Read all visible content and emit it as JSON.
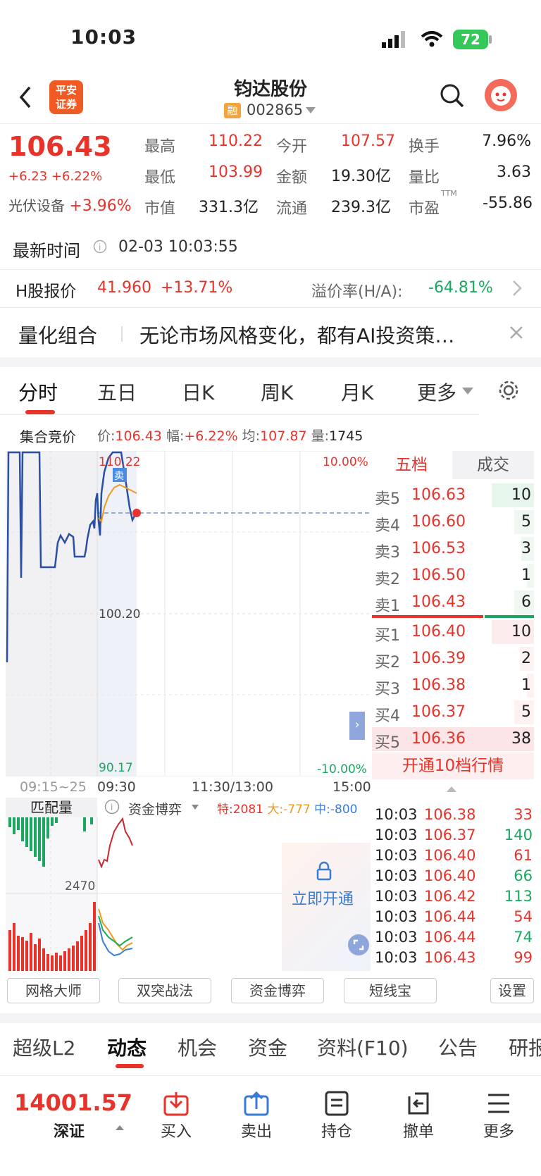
{
  "status": {
    "time": "10:03",
    "battery": "72"
  },
  "header": {
    "logo_line1": "平安",
    "logo_line2": "证券",
    "name": "钧达股份",
    "rong": "融",
    "code": "002865"
  },
  "quote": {
    "price": "106.43",
    "change": "+6.23",
    "change_pct": "+6.22%",
    "sector": "光伏设备",
    "sector_pct": "+3.96%",
    "high_label": "最高",
    "high": "110.22",
    "open_label": "今开",
    "open": "107.57",
    "turnover_label": "换手",
    "turnover": "7.96%",
    "low_label": "最低",
    "low": "103.99",
    "amount_label": "金额",
    "amount": "19.30亿",
    "vol_ratio_label": "量比",
    "vol_ratio": "3.63",
    "mcap_label": "市值",
    "mcap": "331.3亿",
    "float_label": "流通",
    "float": "239.3亿",
    "pe_label": "市盈",
    "pe_sup": "TTM",
    "pe": "-55.86"
  },
  "update": {
    "label": "最新时间",
    "value": "02-03 10:03:55"
  },
  "hshare": {
    "label": "H股报价",
    "price": "41.960",
    "pct": "+13.71%",
    "premium_label": "溢价率(H/A):",
    "premium": "-64.81%"
  },
  "promo": {
    "tag": "量化组合",
    "text": "无论市场风格变化，都有AI投资策…"
  },
  "tabs": [
    "分时",
    "五日",
    "日K",
    "周K",
    "月K",
    "更多"
  ],
  "auction": {
    "label": "集合竞价",
    "price_label": "价:",
    "price": "106.43",
    "pct_label": "幅:",
    "pct": "+6.22%",
    "avg_label": "均:",
    "avg": "107.87",
    "vol_label": "量:",
    "vol": "1745"
  },
  "chart": {
    "top_price": "110.22",
    "mid_price": "100.20",
    "low_price": "90.17",
    "top_pct": "10.00%",
    "low_pct": "-10.00%",
    "sell_mark": "卖",
    "times": [
      "09:15~25",
      "09:30",
      "11:30/13:00",
      "15:00"
    ]
  },
  "subchart": {
    "tab_label": "匹配量",
    "indicator": "资金博弈",
    "te_label": "特:",
    "te": "2081",
    "da_label": "大:",
    "da": "-777",
    "zhong_label": "中:",
    "zhong": "-800",
    "axis_value": "2470",
    "unlock": "立即开通"
  },
  "orderbook": {
    "tab_active": "五档",
    "tab_other": "成交",
    "asks": [
      {
        "label": "卖5",
        "price": "106.63",
        "vol": "10"
      },
      {
        "label": "卖4",
        "price": "106.60",
        "vol": "5"
      },
      {
        "label": "卖3",
        "price": "106.53",
        "vol": "3"
      },
      {
        "label": "卖2",
        "price": "106.50",
        "vol": "1"
      },
      {
        "label": "卖1",
        "price": "106.43",
        "vol": "6"
      }
    ],
    "bids": [
      {
        "label": "买1",
        "price": "106.40",
        "vol": "10"
      },
      {
        "label": "买2",
        "price": "106.39",
        "vol": "2"
      },
      {
        "label": "买3",
        "price": "106.38",
        "vol": "1"
      },
      {
        "label": "买4",
        "price": "106.37",
        "vol": "5"
      },
      {
        "label": "买5",
        "price": "106.36",
        "vol": "38"
      }
    ],
    "upgrade": "开通10档行情"
  },
  "trades": [
    {
      "time": "10:03",
      "price": "106.38",
      "vol": "33",
      "dir": "sell"
    },
    {
      "time": "10:03",
      "price": "106.37",
      "vol": "140",
      "dir": "buy"
    },
    {
      "time": "10:03",
      "price": "106.40",
      "vol": "61",
      "dir": "sell"
    },
    {
      "time": "10:03",
      "price": "106.40",
      "vol": "66",
      "dir": "buy"
    },
    {
      "time": "10:03",
      "price": "106.42",
      "vol": "113",
      "dir": "buy"
    },
    {
      "time": "10:03",
      "price": "106.44",
      "vol": "54",
      "dir": "sell"
    },
    {
      "time": "10:03",
      "price": "106.44",
      "vol": "74",
      "dir": "buy"
    },
    {
      "time": "10:03",
      "price": "106.43",
      "vol": "99",
      "dir": "sell"
    }
  ],
  "tools": [
    "网格大师",
    "双突战法",
    "资金博弈",
    "短线宝",
    "设置"
  ],
  "nav_tabs": [
    "超级L2",
    "动态",
    "机会",
    "资金",
    "资料(F10)",
    "公告",
    "研报"
  ],
  "bottom": {
    "index_value": "14001.57",
    "index_name": "深证",
    "buy": "买入",
    "sell": "卖出",
    "position": "持仓",
    "cancel": "撤单",
    "more": "更多"
  },
  "colors": {
    "up": "#e8332b",
    "down": "#1aa860",
    "accent": "#f15a22",
    "line": "#2b4fa3"
  }
}
